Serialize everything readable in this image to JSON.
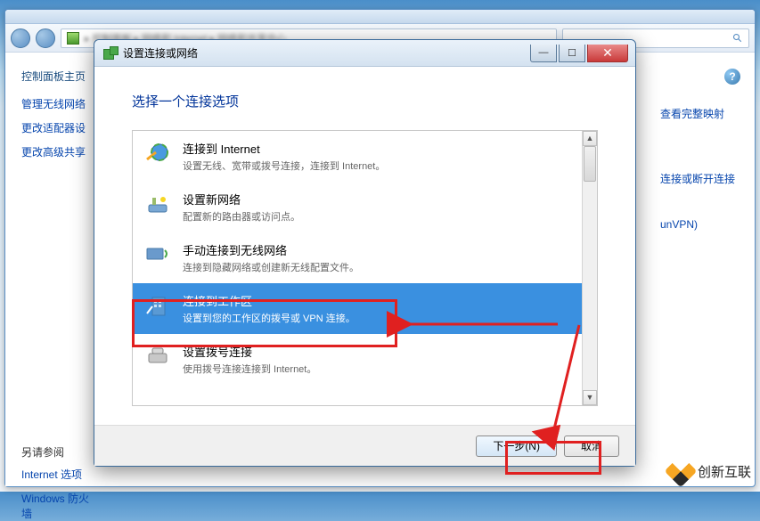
{
  "bg": {
    "side_heading": "控制面板主页",
    "side_items": [
      "管理无线网络",
      "更改适配器设",
      "更改高级共享"
    ],
    "see_also": "另请参阅",
    "see_also_items": [
      "Internet 选项",
      "Windows 防火墙"
    ]
  },
  "bg_right": {
    "link1": "查看完整映射",
    "link2": "连接或断开连接",
    "link3": "unVPN)"
  },
  "dialog": {
    "title": "设置连接或网络",
    "heading": "选择一个连接选项",
    "options": [
      {
        "title": "连接到 Internet",
        "desc": "设置无线、宽带或拨号连接，连接到 Internet。"
      },
      {
        "title": "设置新网络",
        "desc": "配置新的路由器或访问点。"
      },
      {
        "title": "手动连接到无线网络",
        "desc": "连接到隐藏网络或创建新无线配置文件。"
      },
      {
        "title": "连接到工作区",
        "desc": "设置到您的工作区的拨号或 VPN 连接。"
      },
      {
        "title": "设置拨号连接",
        "desc": "使用拨号连接连接到 Internet。"
      }
    ],
    "next": "下一步(N)",
    "cancel": "取消"
  },
  "watermark": "创新互联"
}
